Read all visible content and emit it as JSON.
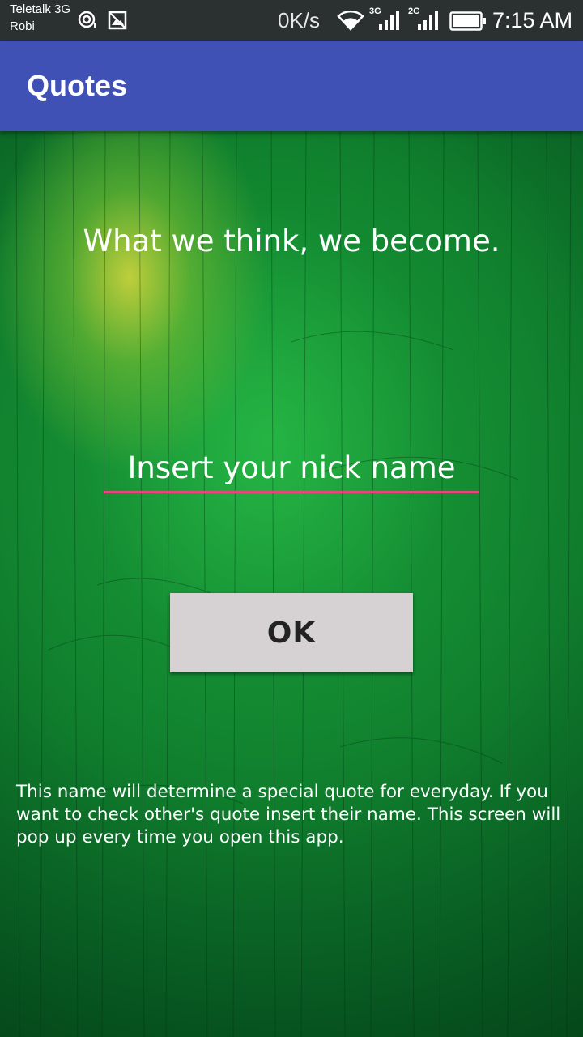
{
  "status_bar": {
    "carrier_1": "Teletalk 3G",
    "carrier_2": "Robi",
    "speed": "0K/s",
    "network_1": "3G",
    "network_2": "2G",
    "time": "7:15 AM",
    "icons": [
      "hotspot-icon",
      "image-icon",
      "wifi-icon",
      "signal-3g-icon",
      "signal-2g-icon",
      "battery-icon"
    ]
  },
  "app_bar": {
    "title": "Quotes",
    "color": "#3f51b5"
  },
  "main": {
    "quote": "What we think, we become.",
    "nick_input": {
      "value": "",
      "placeholder": "Insert your nick name"
    },
    "ok_label": "OK",
    "info": "This name will determine a special quote for everyday. If you want to check other's quote insert their name. This screen will pop up every time you open this app."
  },
  "colors": {
    "accent": "#e8457a",
    "background": "#1c9a3c",
    "button": "#d6d2d3"
  }
}
